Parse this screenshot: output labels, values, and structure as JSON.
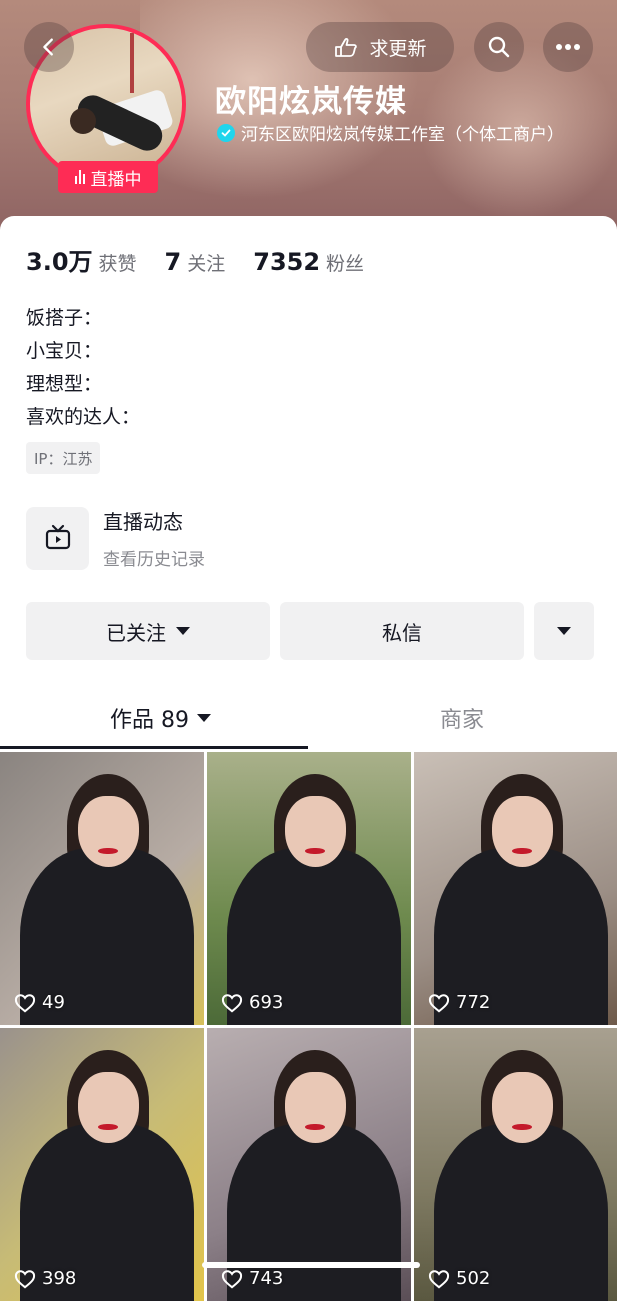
{
  "header": {
    "name": "欧阳炫岚传媒",
    "verified_text": "河东区欧阳炫岚传媒工作室（个体工商户）",
    "live_badge": "直播中",
    "update_button": "求更新"
  },
  "stats": [
    {
      "num": "3.0万",
      "label": "获赞"
    },
    {
      "num": "7",
      "label": "关注"
    },
    {
      "num": "7352",
      "label": "粉丝"
    }
  ],
  "bio": [
    "饭搭子：",
    "小宝贝：",
    "理想型：",
    "喜欢的达人："
  ],
  "ip": "IP：江苏",
  "live_section": {
    "title": "直播动态",
    "subtitle": "查看历史记录"
  },
  "actions": {
    "follow": "已关注",
    "message": "私信"
  },
  "tabs": {
    "works": "作品 89",
    "shop": "商家"
  },
  "videos": [
    {
      "likes": "49"
    },
    {
      "likes": "693"
    },
    {
      "likes": "772"
    },
    {
      "likes": "398"
    },
    {
      "likes": "743"
    },
    {
      "likes": "502"
    }
  ],
  "colors": {
    "accent": "#fe2c55",
    "verify": "#20d5ec"
  }
}
